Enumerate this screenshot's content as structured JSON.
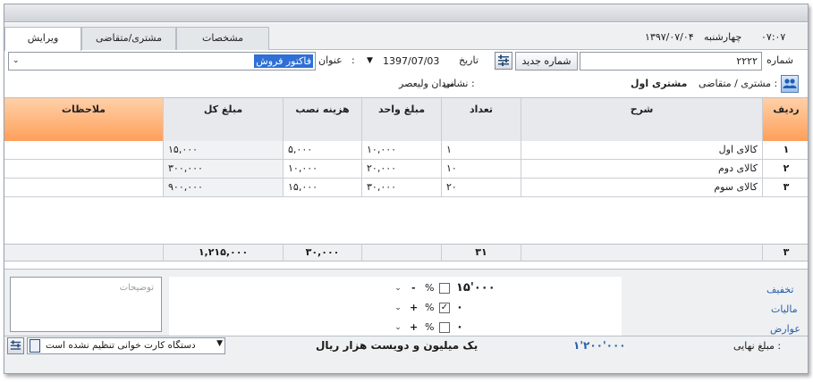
{
  "header": {
    "time": "۰۷:۰۷",
    "weekday": "چهارشنبه",
    "date": "۱۳۹۷/۰۷/۰۴"
  },
  "tabs": [
    {
      "label": "ویرایش"
    },
    {
      "label": "مشتری/متقاضی"
    },
    {
      "label": "مشخصات"
    }
  ],
  "form": {
    "number_label": "شماره",
    "number_value": "۲۲۲۲",
    "new_number_button": "شماره جدید",
    "date_label": "تاریخ",
    "date_value": "1397/07/03",
    "title_label": "عنوان",
    "title_value": "فاکتور فروش",
    "customer_label": "مشتری / متقاضی :",
    "customer_value": "مشتری اول",
    "address_label": "نشانی :",
    "address_value": "میدان ولیعصر"
  },
  "table": {
    "columns": {
      "row": "ردیف",
      "desc": "شرح",
      "qty": "تعداد",
      "unit_price": "مبلغ واحد",
      "install_cost": "هزینه نصب",
      "total": "مبلغ کل",
      "notes": "ملاحظات"
    },
    "rows": [
      {
        "row": "۱",
        "desc": "کالای اول",
        "qty": "۱",
        "unit_price": "۱۰,۰۰۰",
        "install_cost": "۵,۰۰۰",
        "total": "۱۵,۰۰۰",
        "notes": ""
      },
      {
        "row": "۲",
        "desc": "کالای دوم",
        "qty": "۱۰",
        "unit_price": "۲۰,۰۰۰",
        "install_cost": "۱۰,۰۰۰",
        "total": "۳۰۰,۰۰۰",
        "notes": ""
      },
      {
        "row": "۳",
        "desc": "کالای سوم",
        "qty": "۲۰",
        "unit_price": "۳۰,۰۰۰",
        "install_cost": "۱۵,۰۰۰",
        "total": "۹۰۰,۰۰۰",
        "notes": ""
      }
    ],
    "footer": {
      "count": "۳",
      "qty": "۳۱",
      "install_cost": "۳۰,۰۰۰",
      "total": "۱,۲۱۵,۰۰۰"
    }
  },
  "adjustments": {
    "discount_label": "تخفیف",
    "discount_value": "۱۵'۰۰۰",
    "tax_label": "مالیات",
    "tax_value": "۰",
    "duties_label": "عوارض",
    "duties_value": "۰",
    "percent_sign": "%",
    "minus_sign": "-",
    "plus_sign": "+"
  },
  "notes_placeholder": "توضیحات",
  "final": {
    "label": "مبلغ نهایی :",
    "value": "۱'۲۰۰'۰۰۰",
    "words": "یک میلیون و دویست  هزار  ریال"
  },
  "status": {
    "card_reader": "دستگاه کارت خوانی تنظیم نشده است"
  },
  "colors": {
    "accent_orange": "#ff9f5a",
    "link_blue": "#2a5ea8"
  }
}
